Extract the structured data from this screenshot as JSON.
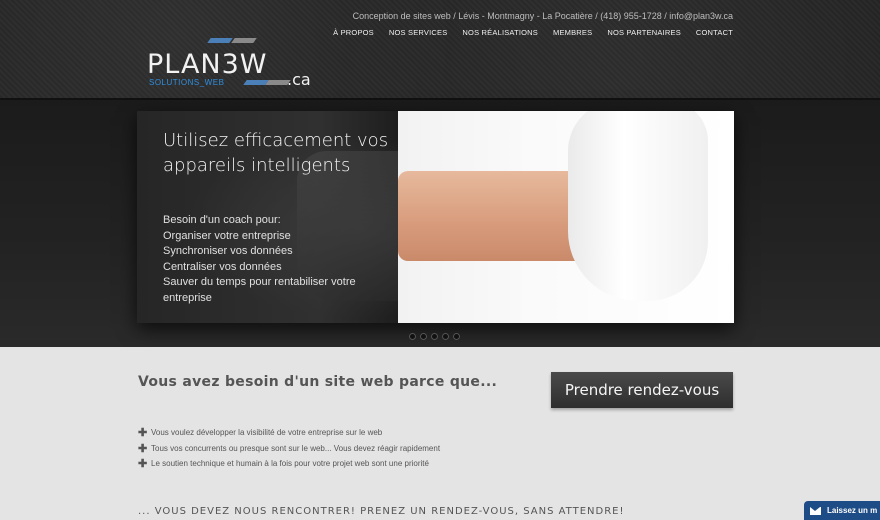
{
  "header": {
    "contact_line": "Conception de sites web / Lévis - Montmagny - La Pocatière / (418) 955-1728 / info@plan3w.ca",
    "nav": [
      "À PROPOS",
      "NOS SERVICES",
      "NOS RÉALISATIONS",
      "MEMBRES",
      "NOS PARTENAIRES",
      "CONTACT"
    ]
  },
  "logo": {
    "main": "PLAN3W",
    "ext": ".ca",
    "sub": "SOLUTIONS_WEB",
    "colors": {
      "text": "#f2f2f2",
      "accent": "#2f8fe0"
    }
  },
  "slider": {
    "title": "Utilisez efficacement vos appareils intelligents",
    "lines": [
      "Besoin d'un coach pour:",
      "Organiser votre entreprise",
      "Synchroniser vos données",
      "Centraliser vos données",
      "Sauver du temps pour rentabiliser votre entreprise"
    ],
    "dot_count": 5
  },
  "content": {
    "why_title": "Vous avez besoin d'un site web parce que...",
    "cta_label": "Prendre rendez-vous",
    "reasons": [
      "Vous voulez développer la visibilité de votre entreprise sur le web",
      "Tous vos concurrents ou presque sont sur le web... Vous devez réagir rapidement",
      "Le soutien technique et humain à la fois pour votre projet web sont une priorité"
    ],
    "tagline": "... VOUS DEVEZ NOUS RENCONTRER! PRENEZ UN RENDEZ-VOUS, SANS ATTENDRE!"
  },
  "feedback": {
    "label": "Laissez un m",
    "icon": "mail-icon"
  }
}
